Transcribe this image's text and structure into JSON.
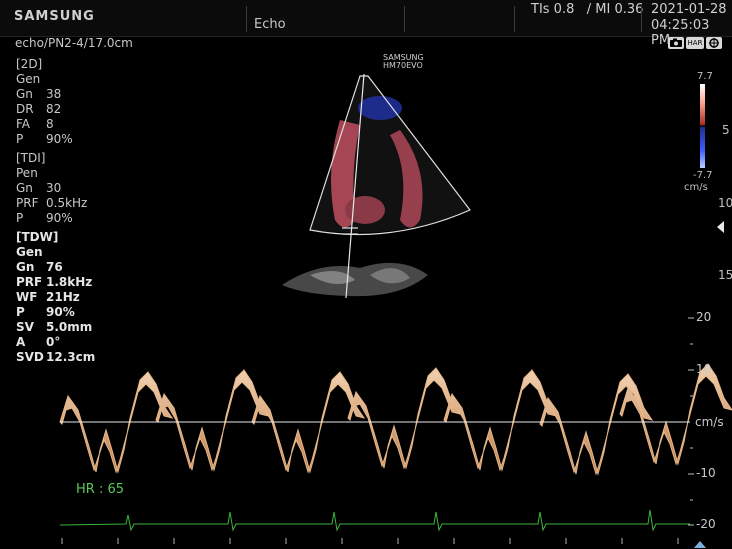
{
  "top_bar": {
    "brand": "SAMSUNG",
    "mode": "Echo",
    "tis_mi": "TIs 0.8   / MI 0.36",
    "date": "2021-01-28",
    "time": "04:25:03 PM"
  },
  "probe": "echo/PN2-4/17.0cm",
  "watermark": {
    "line1": "SAMSUNG",
    "line2": "HM70EVO"
  },
  "status_icons": [
    "camera-icon",
    "HAR",
    "grid-icon"
  ],
  "status_har_label": "HAR",
  "params": {
    "sec_2d": {
      "title": "[2D]",
      "rows": [
        {
          "label": "Gen",
          "value": ""
        },
        {
          "label": "Gn",
          "value": "38"
        },
        {
          "label": "DR",
          "value": "82"
        },
        {
          "label": "FA",
          "value": "8"
        },
        {
          "label": "P",
          "value": "90%"
        }
      ]
    },
    "sec_tdi": {
      "title": "[TDI]",
      "rows": [
        {
          "label": "Pen",
          "value": ""
        },
        {
          "label": "Gn",
          "value": "30"
        },
        {
          "label": "PRF",
          "value": "0.5kHz"
        },
        {
          "label": "P",
          "value": "90%"
        }
      ]
    },
    "sec_tdw": {
      "title": "[TDW]",
      "rows": [
        {
          "label": "Gen",
          "value": ""
        },
        {
          "label": "Gn",
          "value": "76"
        },
        {
          "label": "PRF",
          "value": "1.8kHz"
        },
        {
          "label": "WF",
          "value": "21Hz"
        },
        {
          "label": "P",
          "value": "90%"
        },
        {
          "label": "SV",
          "value": "5.0mm"
        },
        {
          "label": "A",
          "value": "0°"
        },
        {
          "label": "SVD",
          "value": "12.3cm"
        }
      ]
    }
  },
  "color_scale": {
    "top": "7.7",
    "bottom": "-7.7",
    "unit": "cm/s"
  },
  "depth_marks": [
    "5",
    "10",
    "15"
  ],
  "doppler_scale": {
    "labels": [
      "20",
      "10",
      "cm/s",
      "-10",
      "-20"
    ],
    "unit": "cm/s"
  },
  "hr": "HR : 65",
  "colors": {
    "doppler": "#f0c8a0",
    "ecg": "#3cb43c",
    "hr": "#5cc85c"
  }
}
